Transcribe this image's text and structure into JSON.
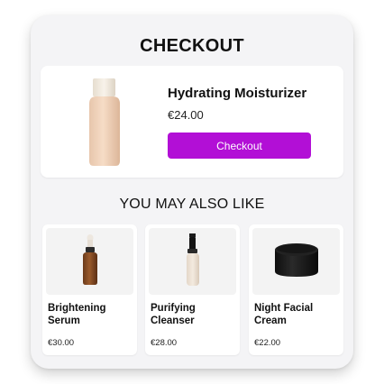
{
  "page": {
    "title": "CHECKOUT"
  },
  "product": {
    "name": "Hydrating Moisturizer",
    "price": "€24.00",
    "image_icon": "cream-bottle-icon",
    "checkout_label": "Checkout"
  },
  "recommendations": {
    "title": "YOU MAY ALSO LIKE",
    "items": [
      {
        "name": "Brightening Serum",
        "price": "€30.00",
        "image_icon": "serum-dropper-bottle-icon"
      },
      {
        "name": "Purifying Cleanser",
        "price": "€28.00",
        "image_icon": "pump-bottle-icon"
      },
      {
        "name": "Night Facial Cream",
        "price": "€22.00",
        "image_icon": "cream-jar-icon"
      }
    ]
  },
  "colors": {
    "accent": "#b20fd6",
    "card_bg": "#f4f4f6",
    "panel_bg": "#ffffff"
  }
}
